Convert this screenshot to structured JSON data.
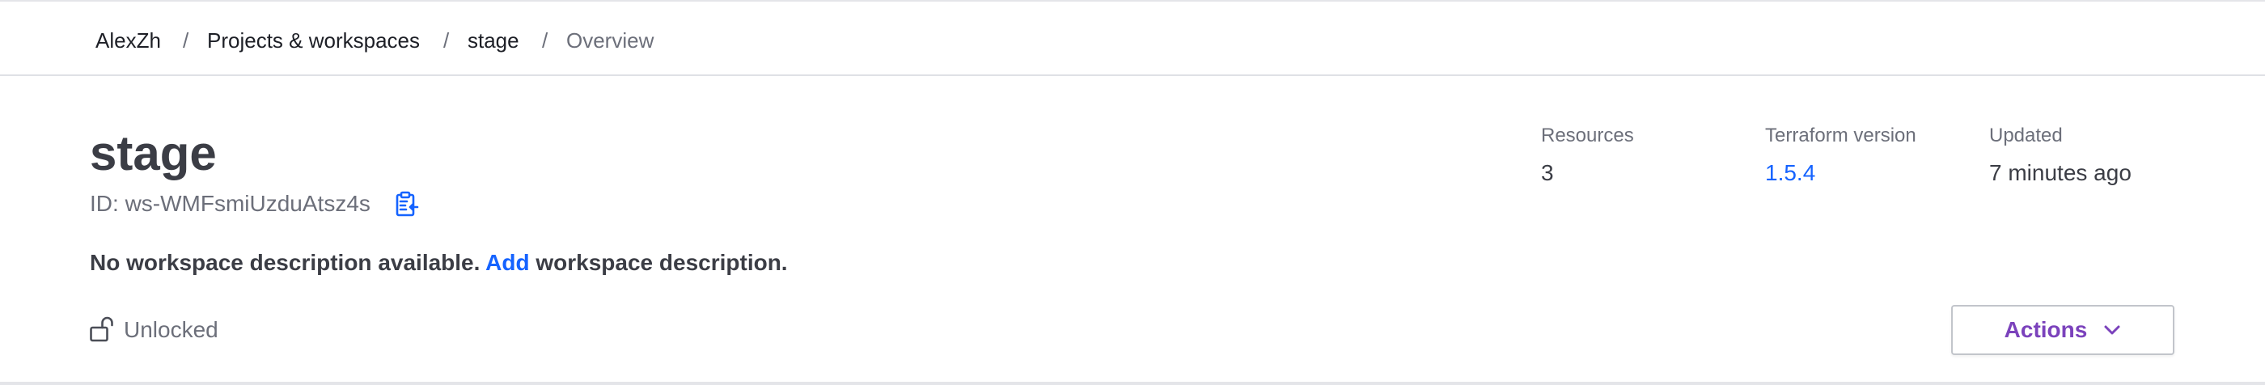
{
  "breadcrumb": {
    "items": [
      {
        "label": "AlexZh"
      },
      {
        "label": "Projects & workspaces"
      },
      {
        "label": "stage"
      },
      {
        "label": "Overview"
      }
    ],
    "separator": "/"
  },
  "workspace": {
    "name": "stage",
    "id_label": "ID:",
    "id": "ws-WMFsmiUzduAtsz4s",
    "description_prefix": "No workspace description available.",
    "description_link": "Add",
    "description_suffix": "workspace description.",
    "lock_status": "Unlocked"
  },
  "stats": {
    "resources_label": "Resources",
    "resources_value": "3",
    "tf_version_label": "Terraform version",
    "tf_version_value": "1.5.4",
    "updated_label": "Updated",
    "updated_value": "7 minutes ago"
  },
  "actions": {
    "label": "Actions",
    "icon": "chevron-down-icon"
  },
  "colors": {
    "link": "#1563ff",
    "actions_text": "#7b42bc",
    "copy_icon": "#1563ff",
    "text_primary": "#3b3d45",
    "text_muted": "#6c6f7a"
  }
}
